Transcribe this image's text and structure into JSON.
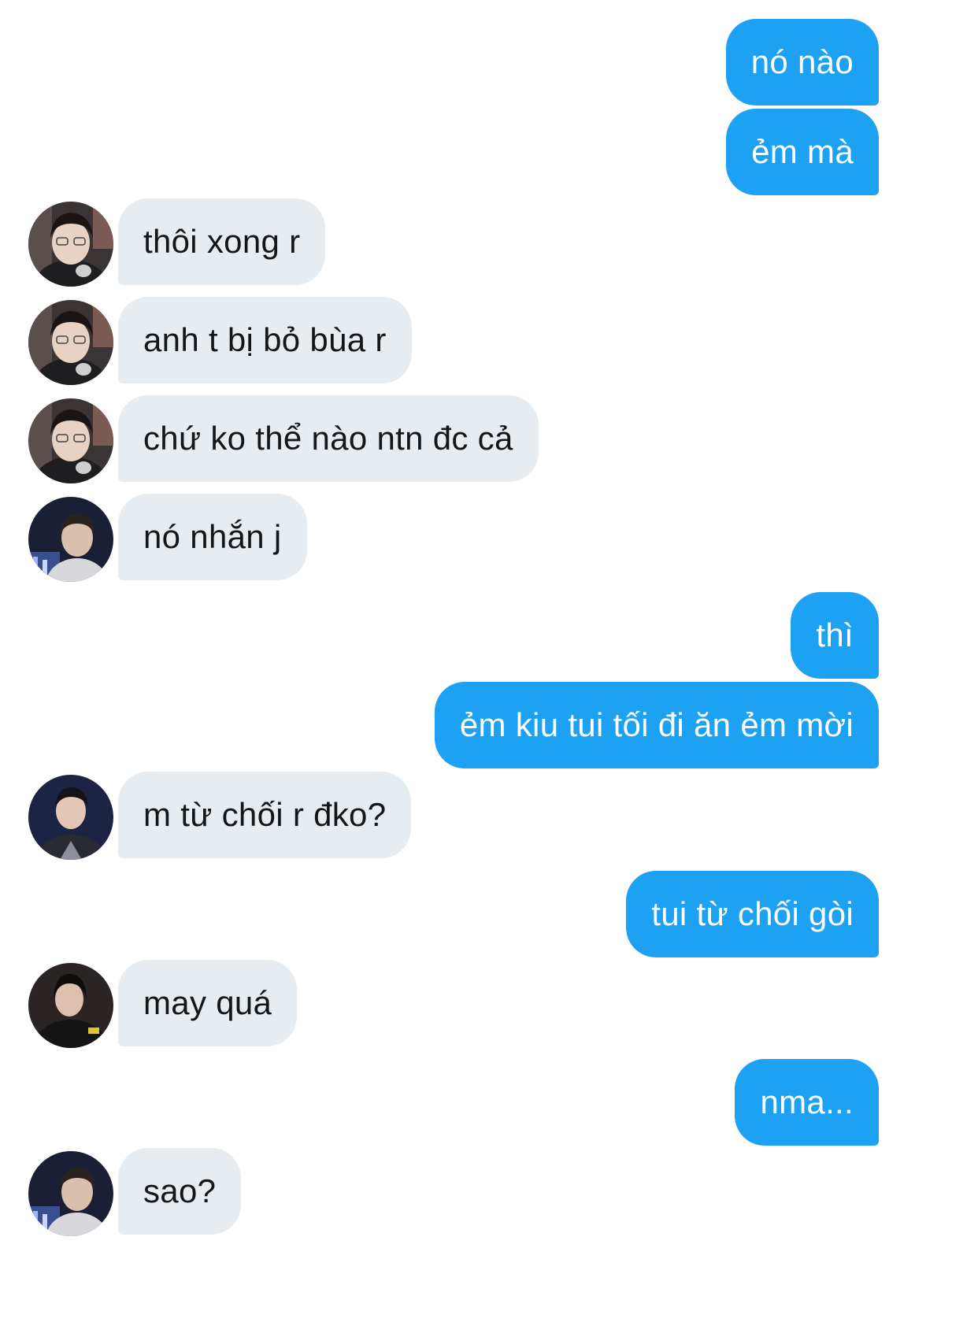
{
  "conversation": {
    "messages": [
      {
        "sender": "me",
        "text": "nó nào"
      },
      {
        "sender": "me",
        "text": "ẻm mà"
      },
      {
        "sender": "them",
        "avatar": "avatar-a",
        "text": "thôi xong r"
      },
      {
        "sender": "them",
        "avatar": "avatar-a",
        "text": "anh t bị bỏ bùa r"
      },
      {
        "sender": "them",
        "avatar": "avatar-a",
        "text": "chứ ko thể nào ntn đc cả"
      },
      {
        "sender": "them",
        "avatar": "avatar-b",
        "text": "nó nhắn j"
      },
      {
        "sender": "me",
        "text": "thì"
      },
      {
        "sender": "me",
        "text": "ẻm kiu tui tối đi ăn ẻm mời"
      },
      {
        "sender": "them",
        "avatar": "avatar-c",
        "text": "m từ chối r đko?"
      },
      {
        "sender": "me",
        "text": "tui từ chối gòi"
      },
      {
        "sender": "them",
        "avatar": "avatar-d",
        "text": "may quá"
      },
      {
        "sender": "me",
        "text": "nma..."
      },
      {
        "sender": "them",
        "avatar": "avatar-b",
        "text": "sao?"
      }
    ]
  },
  "colors": {
    "outgoing_bubble": "#1da1f2",
    "incoming_bubble": "#e6ecf0",
    "outgoing_text": "#ffffff",
    "incoming_text": "#14171a"
  }
}
